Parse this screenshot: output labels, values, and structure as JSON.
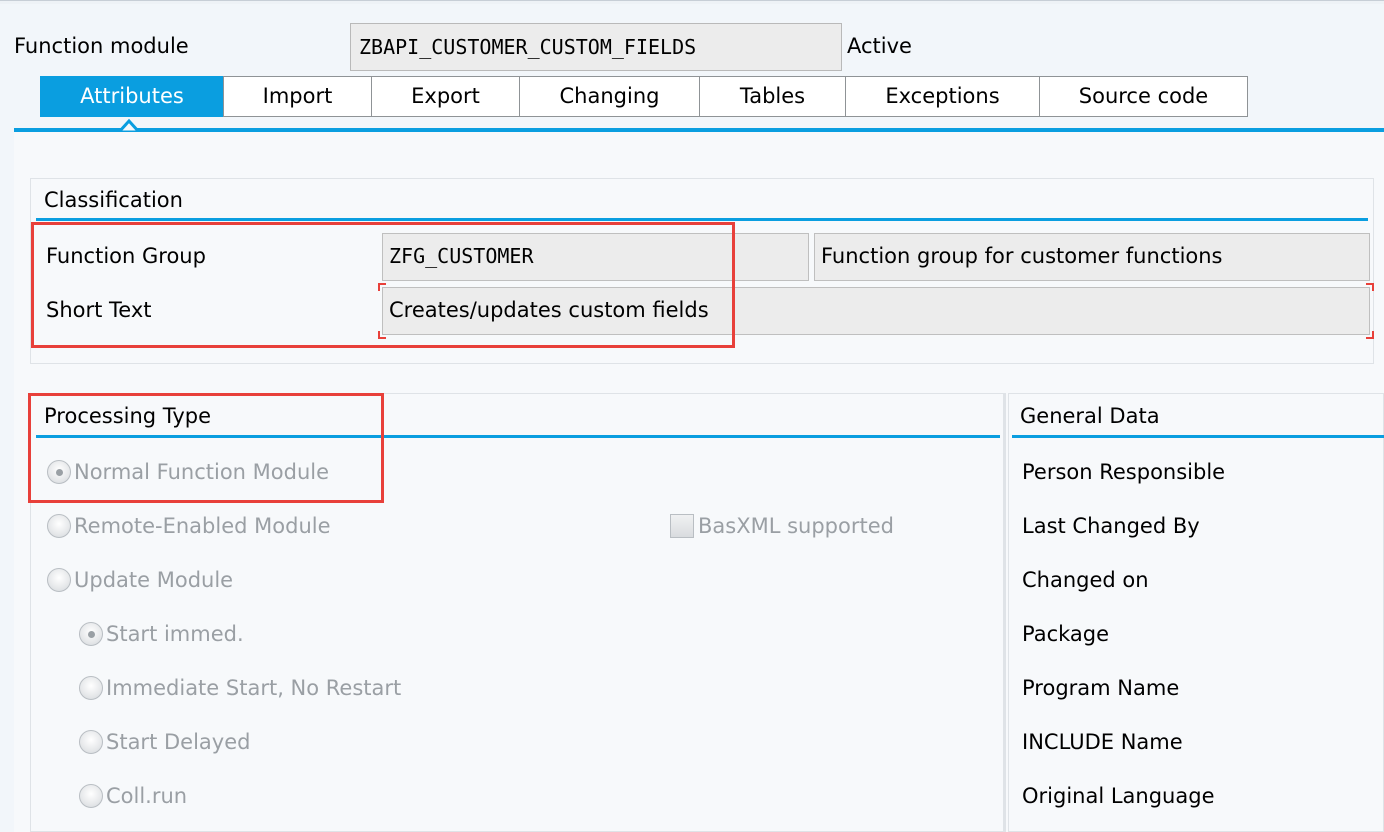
{
  "header": {
    "label": "Function module",
    "module_name": "ZBAPI_CUSTOMER_CUSTOM_FIELDS",
    "status": "Active"
  },
  "tabs": [
    {
      "label": "Attributes",
      "active": true
    },
    {
      "label": "Import"
    },
    {
      "label": "Export"
    },
    {
      "label": "Changing"
    },
    {
      "label": "Tables"
    },
    {
      "label": "Exceptions"
    },
    {
      "label": "Source code"
    }
  ],
  "classification": {
    "title": "Classification",
    "function_group_label": "Function Group",
    "function_group_value": "ZFG_CUSTOMER",
    "function_group_description": "Function group for customer functions",
    "short_text_label": "Short Text",
    "short_text_value": "Creates/updates custom fields"
  },
  "processing_type": {
    "title": "Processing Type",
    "options": [
      {
        "label": "Normal Function Module",
        "selected": true
      },
      {
        "label": "Remote-Enabled Module",
        "selected": false
      },
      {
        "label": "Update Module",
        "selected": false
      }
    ],
    "basxml_label": "BasXML supported",
    "basxml_checked": false,
    "update_options": [
      {
        "label": "Start immed.",
        "selected": true
      },
      {
        "label": "Immediate Start, No Restart",
        "selected": false
      },
      {
        "label": "Start Delayed",
        "selected": false
      },
      {
        "label": "Coll.run",
        "selected": false
      }
    ]
  },
  "general_data": {
    "title": "General Data",
    "fields": [
      "Person Responsible",
      "Last Changed By",
      "Changed on",
      "Package",
      "Program Name",
      "INCLUDE Name",
      "Original Language"
    ]
  },
  "colors": {
    "accent": "#0a9ee0",
    "highlight": "#e8403a",
    "field_bg": "#ececec"
  }
}
